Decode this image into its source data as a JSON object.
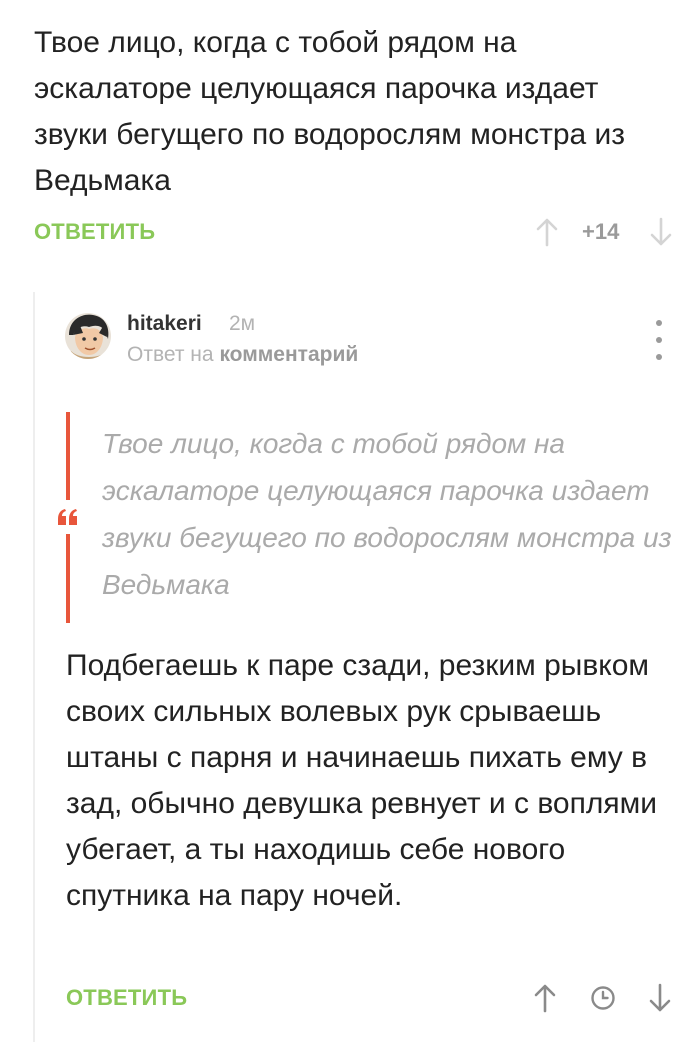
{
  "parent_comment": {
    "text": "Твое лицо, когда с тобой рядом на эскалаторе целующаяся парочка издает звуки бегущего по водорослям монстра из Ведьмака",
    "reply_label": "ОТВЕТИТЬ",
    "rating": "+14",
    "icons": {
      "upvote": "arrow-up-icon",
      "downvote": "arrow-down-icon"
    }
  },
  "reply": {
    "username": "hitakeri",
    "time": "2м",
    "reply_prefix": "Ответ на",
    "reply_target": "комментарий",
    "quote": "Твое лицо, когда с тобой рядом на эскалаторе целующаяся парочка издает звуки бегущего по водорослям монстра из Ведьмака",
    "quote_mark": "“",
    "text": "Подбегаешь к паре сзади, резким рывком своих сильных волевых рук срываешь штаны с парня и начинаешь пихать ему в зад, обычно девушка ревнует и с воплями убегает, а ты находишь себе нового спутника на пару ночей.",
    "reply_label": "ОТВЕТИТЬ",
    "icons": {
      "upvote": "arrow-up-icon",
      "pending": "clock-icon",
      "downvote": "arrow-down-icon",
      "more": "more-vertical-icon"
    }
  },
  "colors": {
    "accent_green": "#8ac858",
    "quote_red": "#e8563b",
    "muted": "#b3b3b3"
  }
}
